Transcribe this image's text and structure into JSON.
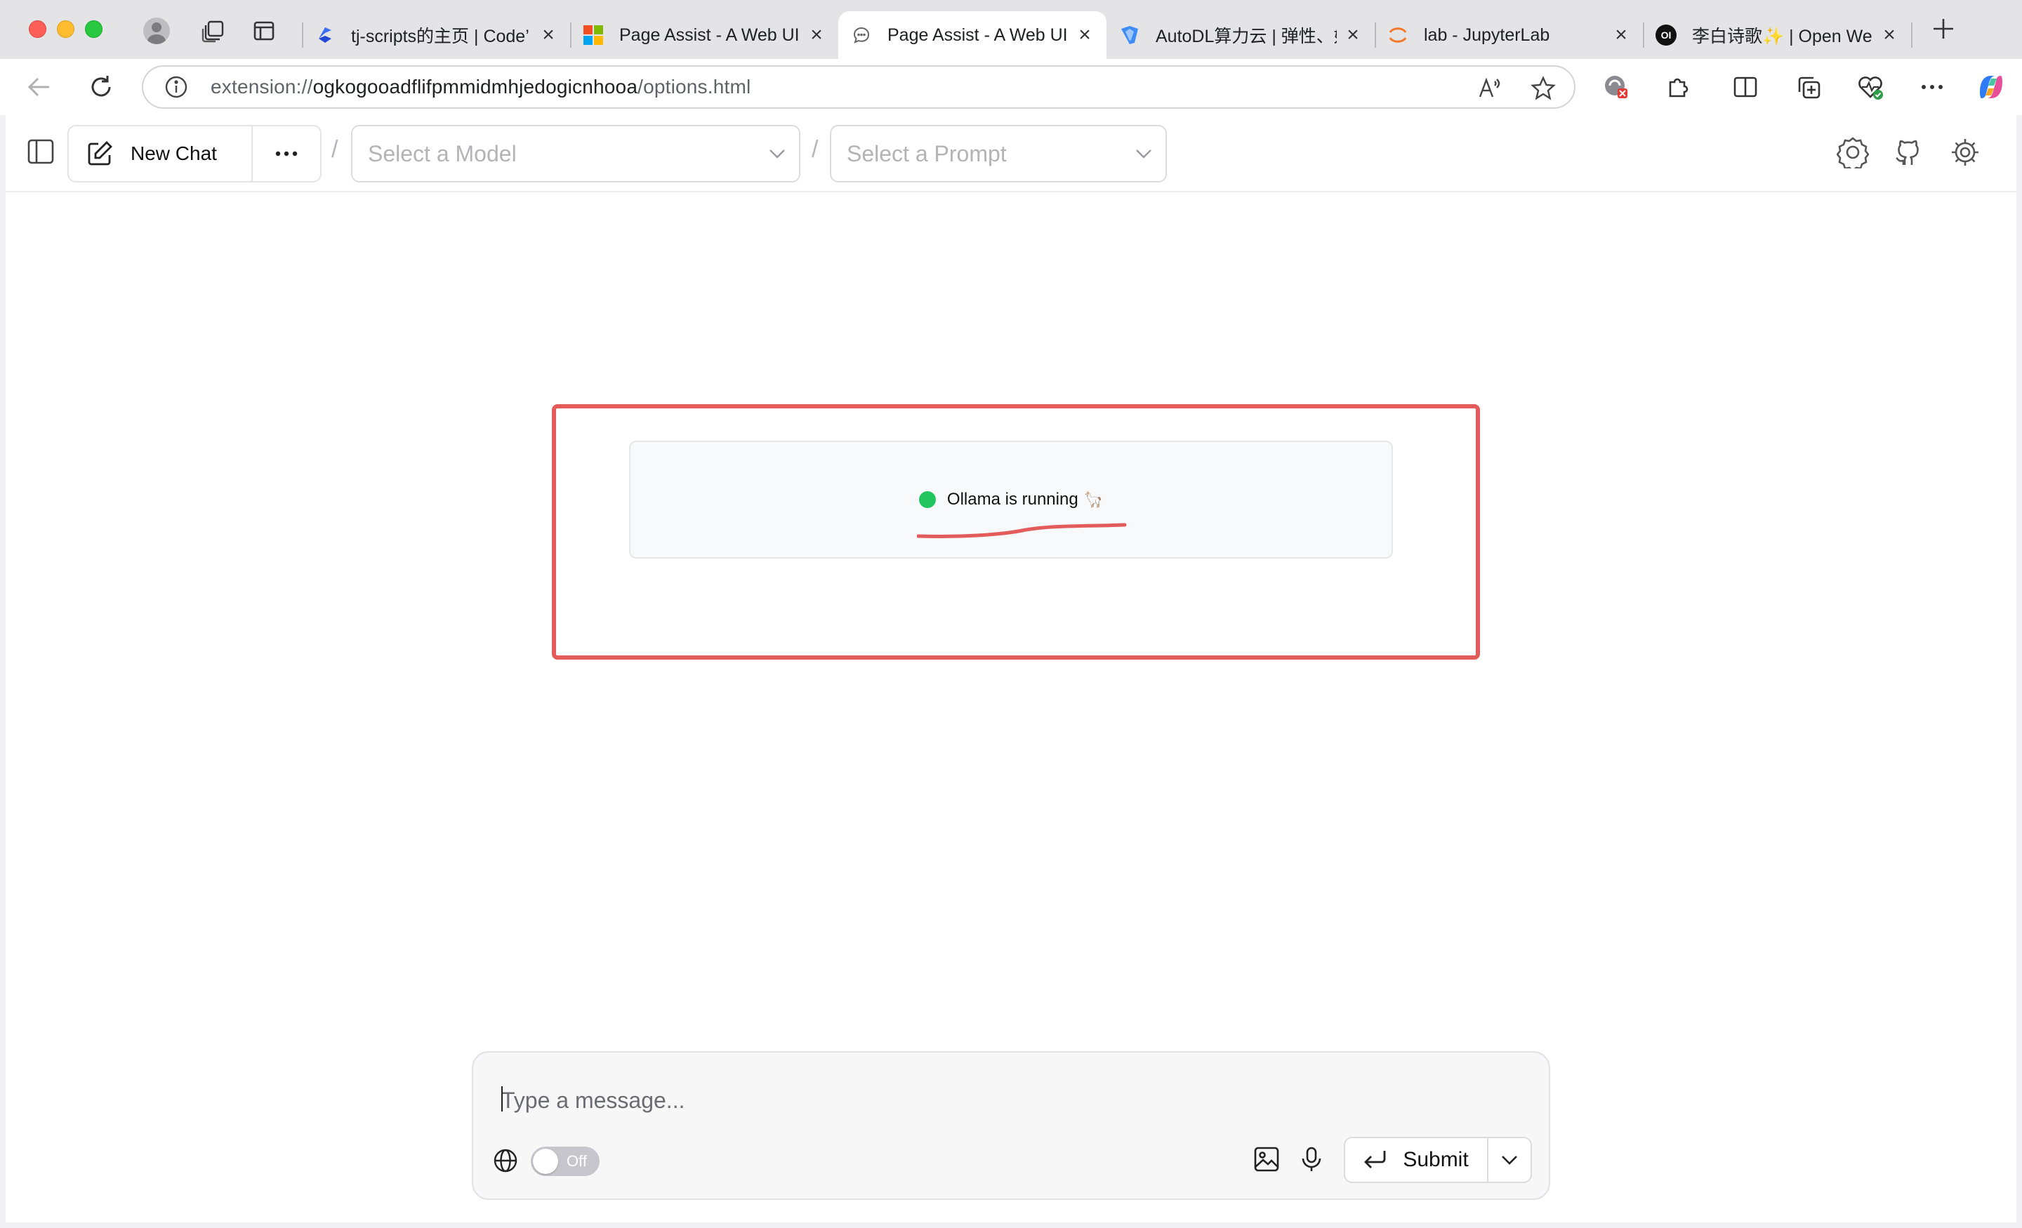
{
  "browser": {
    "tabs": [
      {
        "title": "tj-scripts的主页 | Code’",
        "favicon": "codeup-logo-icon"
      },
      {
        "title": "Page Assist - A Web UI",
        "favicon": "microsoft-logo-icon"
      },
      {
        "title": "Page Assist - A Web UI",
        "favicon": "chat-bubble-icon",
        "active": true
      },
      {
        "title": "AutoDL算力云 | 弹性、好",
        "favicon": "autodl-logo-icon"
      },
      {
        "title": "lab - JupyterLab",
        "favicon": "jupyter-logo-icon"
      },
      {
        "title": "李白诗歌✨ | Open Web",
        "favicon": "openwebui-logo-icon"
      }
    ],
    "openwebui_favicon_text": "OI",
    "url_scheme": "extension://",
    "url_host": "ogkogooadflifpmmidmhjedogicnhooa",
    "url_path": "/options.html"
  },
  "header": {
    "new_chat_label": "New Chat",
    "model_select_placeholder": "Select a Model",
    "prompt_select_placeholder": "Select a Prompt",
    "separator": "/"
  },
  "status": {
    "text": "Ollama is running",
    "emoji": "🦙",
    "dot_color": "#22c55e"
  },
  "composer": {
    "placeholder": "Type a message...",
    "web_search_toggle_label": "Off",
    "web_search_enabled": false,
    "submit_label": "Submit"
  },
  "colors": {
    "highlight_annotation": "#e35b5b"
  }
}
